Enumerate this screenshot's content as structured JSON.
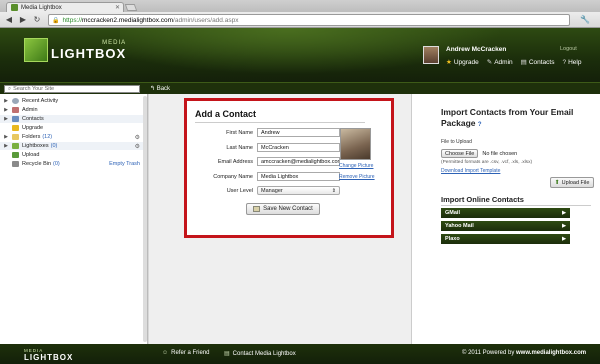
{
  "browser": {
    "tab_title": "Media Lightbox",
    "url_scheme": "https://",
    "url_host": "mccracken2.medialightbox.com",
    "url_path": "/admin/users/add.aspx"
  },
  "header": {
    "logo_top": "MEDIA",
    "logo_bottom": "LIGHTBOX",
    "user_name": "Andrew McCracken",
    "logout": "Logout",
    "links": [
      {
        "label": "Upgrade",
        "icon": "star-icon"
      },
      {
        "label": "Admin",
        "icon": "wrench-icon"
      },
      {
        "label": "Contacts",
        "icon": "contacts-icon"
      },
      {
        "label": "Help",
        "icon": "help-icon"
      }
    ]
  },
  "subnav": {
    "search_placeholder": "Search Your Site",
    "back": "Back"
  },
  "sidebar": {
    "items": [
      {
        "label": "Recent Activity",
        "count": "",
        "icon": "clock-icon"
      },
      {
        "label": "Admin",
        "count": "",
        "icon": "admin-icon"
      },
      {
        "label": "Contacts",
        "count": "",
        "icon": "contacts-icon"
      },
      {
        "label": "Upgrade",
        "count": "",
        "icon": "star-icon"
      },
      {
        "label": "Folders",
        "count": "(12)",
        "icon": "folder-icon"
      },
      {
        "label": "Lightboxes",
        "count": "(0)",
        "icon": "lightbox-icon"
      },
      {
        "label": "Upload",
        "count": "",
        "icon": "upload-icon"
      },
      {
        "label": "Recycle Bin",
        "count": "(0)",
        "icon": "trash-icon"
      }
    ],
    "empty_trash": "Empty Trash"
  },
  "form": {
    "title": "Add a Contact",
    "fields": {
      "first_name": {
        "label": "First Name",
        "value": "Andrew"
      },
      "last_name": {
        "label": "Last Name",
        "value": "McCracken"
      },
      "email": {
        "label": "Email Address",
        "value": "amccracken@medialightbox.com"
      },
      "company": {
        "label": "Company Name",
        "value": "Media Lightbox"
      },
      "user_level": {
        "label": "User Level",
        "value": "Manager"
      }
    },
    "change_picture": "Change Picture",
    "remove_picture": "Remove Picture",
    "save_button": "Save New Contact"
  },
  "import": {
    "title": "Import Contacts from Your Email Package",
    "help": "?",
    "file_label": "File to Upload",
    "choose_file": "Choose File",
    "no_file": "No file chosen",
    "permitted": "(Permitted formats are .csv, .vcf, .xls, .xlsx)",
    "download_template": "Download Import Template",
    "upload_button": "Upload File",
    "online_title": "Import Online Contacts",
    "services": [
      "GMail",
      "Yahoo Mail",
      "Plaxo"
    ]
  },
  "footer": {
    "logo_top": "MEDIA",
    "logo_bottom": "LIGHTBOX",
    "refer": "Refer a Friend",
    "contact": "Contact Media Lightbox",
    "copyright_prefix": "© 2011 Powered by ",
    "copyright_site": "www.medialightbox.com"
  },
  "colors": {
    "brand_green": "#1b2d0b",
    "highlight_red": "#c4141a",
    "link_blue": "#2d62b6"
  }
}
